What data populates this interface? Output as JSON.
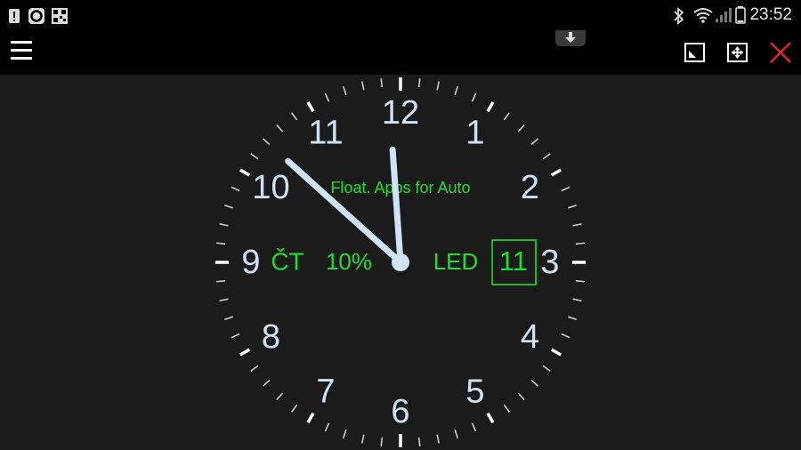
{
  "status_bar": {
    "time": "23:52",
    "icons": [
      "alert-icon",
      "app-c-icon",
      "qr-icon",
      "bluetooth-icon",
      "wifi-icon",
      "signal-icon",
      "battery-icon"
    ]
  },
  "toolbar": {
    "menu_icon": "hamburger-icon",
    "resize_icon": "resize-icon",
    "move_icon": "move-icon",
    "close_icon": "close-icon",
    "close_color": "#e0242b"
  },
  "clock": {
    "numerals": [
      "12",
      "1",
      "2",
      "3",
      "4",
      "5",
      "6",
      "7",
      "8",
      "9",
      "10",
      "11"
    ],
    "app_label": "Float. Apps for Auto",
    "weekday": "ČT",
    "battery": "10%",
    "led_label": "LED",
    "date": "11",
    "hand_color": "#cfe3f6",
    "info_color": "#22dd33",
    "time_shown": {
      "hour": 11,
      "minute": 52
    }
  }
}
